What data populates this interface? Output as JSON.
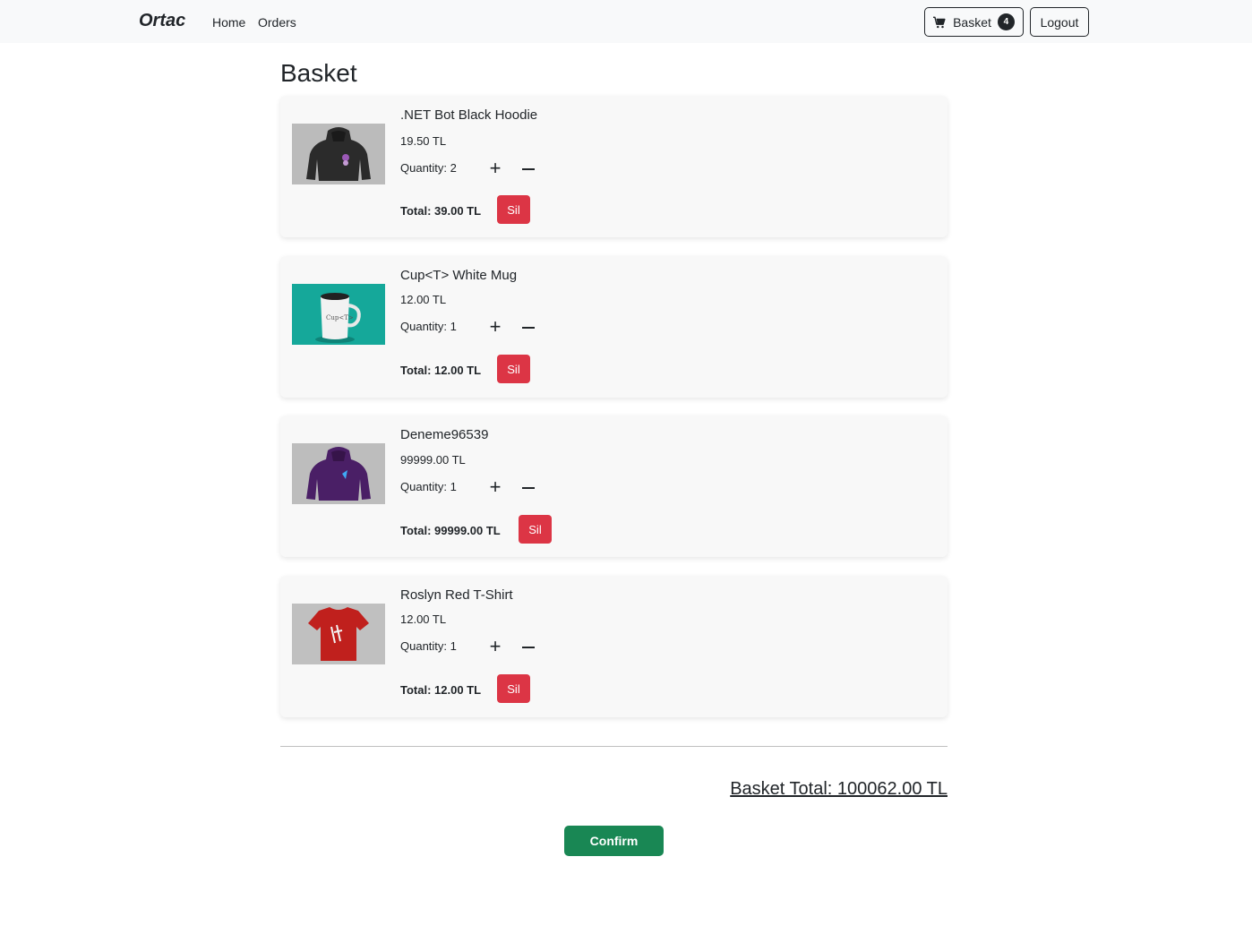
{
  "navbar": {
    "brand": "Ortac",
    "links": [
      {
        "label": "Home"
      },
      {
        "label": "Orders"
      }
    ],
    "basket_label": "Basket",
    "basket_count": "4",
    "logout_label": "Logout",
    "cart_icon": "cart-icon"
  },
  "page": {
    "title": "Basket"
  },
  "items": [
    {
      "name": ".NET Bot Black Hoodie",
      "price": "19.50 TL",
      "quantity": "Quantity: 2",
      "total": "Total: 39.00 TL",
      "delete_label": "Sil",
      "image": "hoodie-black"
    },
    {
      "name": "Cup<T> White Mug",
      "price": "12.00 TL",
      "quantity": "Quantity: 1",
      "total": "Total: 12.00 TL",
      "delete_label": "Sil",
      "image": "mug-white"
    },
    {
      "name": "Deneme96539",
      "price": "99999.00 TL",
      "quantity": "Quantity: 1",
      "total": "Total: 99999.00 TL",
      "delete_label": "Sil",
      "image": "hoodie-purple"
    },
    {
      "name": "Roslyn Red T-Shirt",
      "price": "12.00 TL",
      "quantity": "Quantity: 1",
      "total": "Total: 12.00 TL",
      "delete_label": "Sil",
      "image": "tshirt-red"
    }
  ],
  "quantity_controls": {
    "plus": "+",
    "minus_icon": "minus-icon"
  },
  "summary": {
    "basket_total": "Basket Total: 100062.00 TL",
    "confirm_label": "Confirm"
  },
  "colors": {
    "danger": "#dc3545",
    "success": "#198754",
    "dark": "#212529",
    "navbar_bg": "#f8f9fa",
    "card_bg": "#f8f8f8"
  }
}
